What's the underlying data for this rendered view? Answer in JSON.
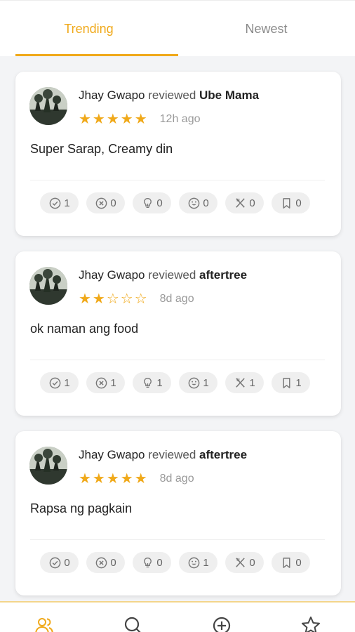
{
  "tabs": [
    {
      "label": "Trending",
      "active": true
    },
    {
      "label": "Newest",
      "active": false
    }
  ],
  "accent_color": "#f0a91a",
  "reviews": [
    {
      "user": "Jhay Gwapo",
      "verb": "reviewed",
      "place": "Ube Mama",
      "rating": 5,
      "stars": "★★★★★",
      "time": "12h ago",
      "text": "Super Sarap, Creamy din",
      "reactions": [
        {
          "icon": "check-circle-icon",
          "count": "1"
        },
        {
          "icon": "x-circle-icon",
          "count": "0"
        },
        {
          "icon": "lightbulb-icon",
          "count": "0"
        },
        {
          "icon": "smiley-icon",
          "count": "0"
        },
        {
          "icon": "utensils-icon",
          "count": "0"
        },
        {
          "icon": "bookmark-icon",
          "count": "0"
        }
      ]
    },
    {
      "user": "Jhay Gwapo",
      "verb": "reviewed",
      "place": "aftertree",
      "rating": 2,
      "stars": "★★☆☆☆",
      "time": "8d ago",
      "text": "ok naman ang food",
      "reactions": [
        {
          "icon": "check-circle-icon",
          "count": "1"
        },
        {
          "icon": "x-circle-icon",
          "count": "1"
        },
        {
          "icon": "lightbulb-icon",
          "count": "1"
        },
        {
          "icon": "smiley-icon",
          "count": "1"
        },
        {
          "icon": "utensils-icon",
          "count": "1"
        },
        {
          "icon": "bookmark-icon",
          "count": "1"
        }
      ]
    },
    {
      "user": "Jhay Gwapo",
      "verb": "reviewed",
      "place": "aftertree",
      "rating": 5,
      "stars": "★★★★★",
      "time": "8d ago",
      "text": "Rapsa ng pagkain",
      "reactions": [
        {
          "icon": "check-circle-icon",
          "count": "0"
        },
        {
          "icon": "x-circle-icon",
          "count": "0"
        },
        {
          "icon": "lightbulb-icon",
          "count": "0"
        },
        {
          "icon": "smiley-icon",
          "count": "1"
        },
        {
          "icon": "utensils-icon",
          "count": "0"
        },
        {
          "icon": "bookmark-icon",
          "count": "0"
        }
      ]
    }
  ],
  "bottom_nav": [
    {
      "icon": "users-icon",
      "active": true
    },
    {
      "icon": "search-icon",
      "active": false
    },
    {
      "icon": "add-circle-icon",
      "active": false
    },
    {
      "icon": "star-icon",
      "active": false
    }
  ]
}
